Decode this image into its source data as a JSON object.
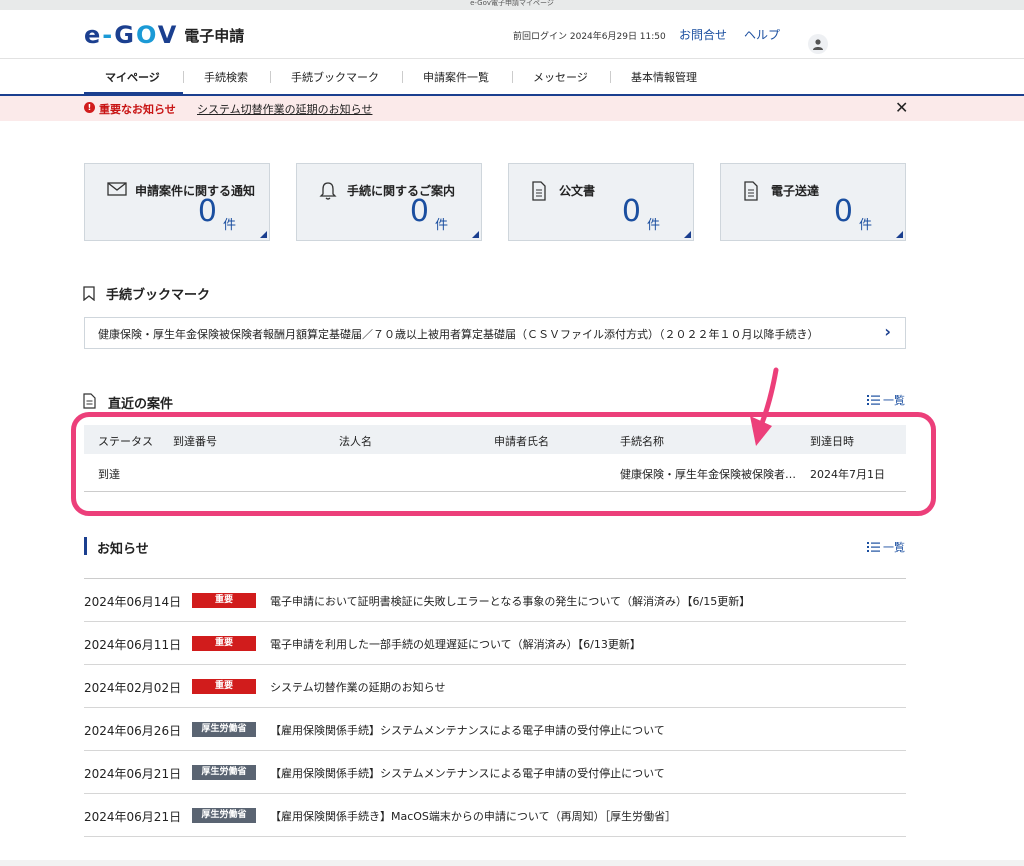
{
  "window": {
    "title": "e-Gov電子申請マイページ"
  },
  "header": {
    "logo_mark": "e-GOV",
    "logo_text": "電子申請",
    "last_login": "前回ログイン 2024年6月29日 11:50",
    "contact": "お問合せ",
    "help": "ヘルプ"
  },
  "nav": {
    "items": [
      {
        "label": "マイページ"
      },
      {
        "label": "手続検索"
      },
      {
        "label": "手続ブックマーク"
      },
      {
        "label": "申請案件一覧"
      },
      {
        "label": "メッセージ"
      },
      {
        "label": "基本情報管理"
      }
    ],
    "active": "マイページ"
  },
  "alert": {
    "label": "重要なお知らせ",
    "link": "システム切替作業の延期のお知らせ",
    "close": "✕"
  },
  "cards": [
    {
      "label": "申請案件に関する通知",
      "count": "0",
      "unit": "件",
      "icon": "mail-icon"
    },
    {
      "label": "手続に関するご案内",
      "count": "0",
      "unit": "件",
      "icon": "bell-icon"
    },
    {
      "label": "公文書",
      "count": "0",
      "unit": "件",
      "icon": "document-icon"
    },
    {
      "label": "電子送達",
      "count": "0",
      "unit": "件",
      "icon": "document-icon"
    }
  ],
  "bookmarks": {
    "title": "手続ブックマーク",
    "items": [
      {
        "text": "健康保険・厚生年金保険被保険者報酬月額算定基礎届／７０歳以上被用者算定基礎届（ＣＳＶファイル添付方式）（２０２２年１０月以降手続き）"
      }
    ]
  },
  "recent_cases": {
    "title": "直近の案件",
    "list_link": "一覧",
    "columns": [
      "ステータス",
      "到達番号",
      "法人名",
      "申請者氏名",
      "手続名称",
      "到達日時"
    ],
    "rows": [
      {
        "status": "到達",
        "number": "",
        "corp": "",
        "applicant": "",
        "procedure": "健康保険・厚生年金保険被保険者…",
        "date": "2024年7月1日"
      }
    ]
  },
  "news": {
    "title": "お知らせ",
    "list_link": "一覧",
    "items": [
      {
        "date": "2024年06月14日",
        "badge": "重要",
        "type": "important",
        "title": "電子申請において証明書検証に失敗しエラーとなる事象の発生について（解消済み）【6/15更新】"
      },
      {
        "date": "2024年06月11日",
        "badge": "重要",
        "type": "important",
        "title": "電子申請を利用した一部手続の処理遅延について（解消済み）【6/13更新】"
      },
      {
        "date": "2024年02月02日",
        "badge": "重要",
        "type": "important",
        "title": "システム切替作業の延期のお知らせ"
      },
      {
        "date": "2024年06月26日",
        "badge": "厚生労働省",
        "type": "ministry",
        "title": "【雇用保険関係手続】システムメンテナンスによる電子申請の受付停止について"
      },
      {
        "date": "2024年06月21日",
        "badge": "厚生労働省",
        "type": "ministry",
        "title": "【雇用保険関係手続】システムメンテナンスによる電子申請の受付停止について"
      },
      {
        "date": "2024年06月21日",
        "badge": "厚生労働省",
        "type": "ministry",
        "title": "【雇用保険関係手続き】MacOS端末からの申請について（再周知）［厚生労働省］"
      }
    ]
  },
  "colors": {
    "brand": "#1b3f8f",
    "accent": "#1b9ad6",
    "important": "#d11c1c",
    "ministry": "#5a6472",
    "highlight": "#ec3f7a"
  }
}
